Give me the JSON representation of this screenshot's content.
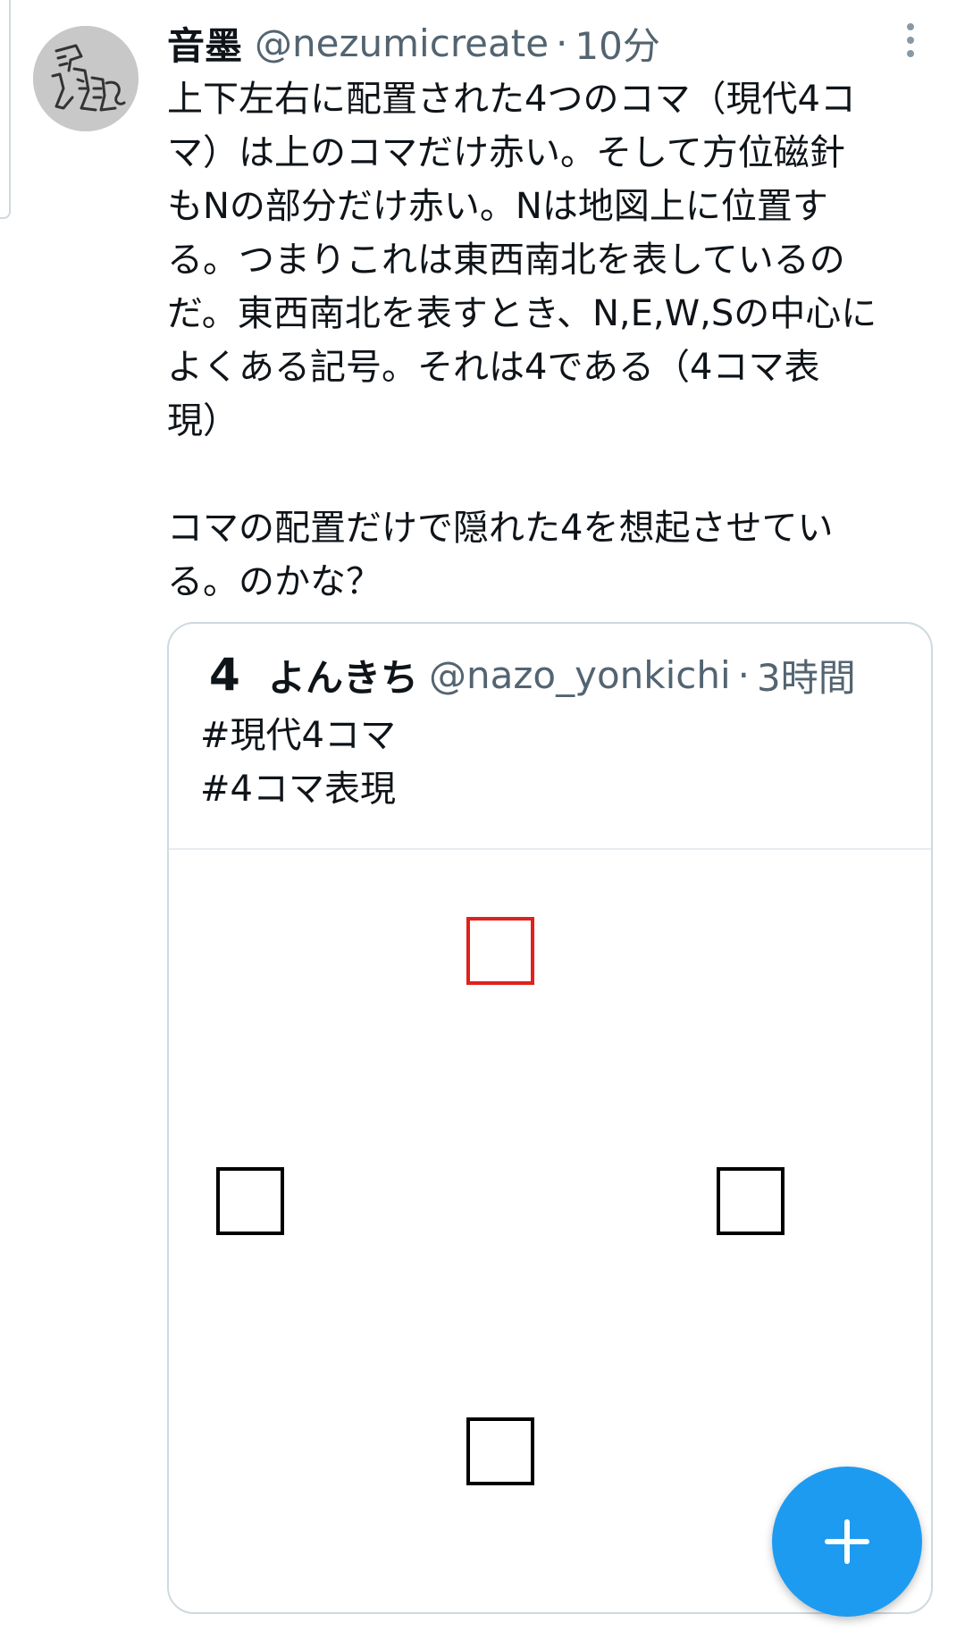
{
  "tweet": {
    "display_name": "音墨",
    "handle": "@nezumicreate",
    "separator": "·",
    "time": "10分",
    "avatar_icon": "rat-drawing-avatar-icon",
    "more_icon": "more-vertical-icon",
    "text_lines": [
      "上下左右に配置された4つのコマ（現代4コ",
      "マ）は上のコマだけ赤い。そして方位磁針",
      "もNの部分だけ赤い。Nは地図上に位置す",
      "る。つまりこれは東西南北を表しているの",
      "だ。東西南北を表すとき、N,E,W,Sの中心に",
      "よくある記号。それは4である（4コマ表",
      "現）"
    ],
    "text_lines_2": [
      "コマの配置だけで隠れた4を想起させてい",
      "る。のかな？"
    ]
  },
  "quote": {
    "avatar_text": "4",
    "display_name": "よんきち",
    "handle": "@nazo_yonkichi",
    "separator": "·",
    "time": "3時間",
    "hashtags": [
      "#現代4コマ",
      "#4コマ表現"
    ],
    "panels": [
      {
        "position": "top",
        "color": "#e0211d"
      },
      {
        "position": "left",
        "color": "#000000"
      },
      {
        "position": "right",
        "color": "#000000"
      },
      {
        "position": "bottom",
        "color": "#000000"
      }
    ]
  },
  "fab": {
    "icon": "plus-icon",
    "color": "#1d9bf0"
  }
}
